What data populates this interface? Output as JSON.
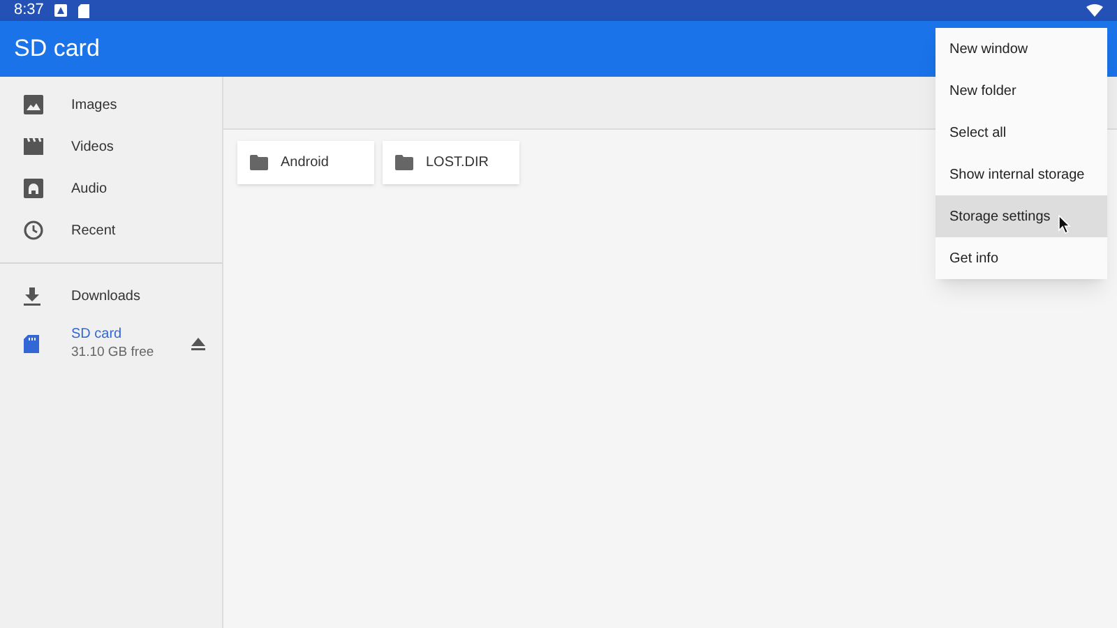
{
  "status_bar": {
    "time": "8:37"
  },
  "app_bar": {
    "title": "SD card"
  },
  "sidebar": {
    "groups": [
      {
        "items": [
          {
            "label": "Images",
            "kind": "images",
            "selected": false
          },
          {
            "label": "Videos",
            "kind": "videos",
            "selected": false
          },
          {
            "label": "Audio",
            "kind": "audio",
            "selected": false
          },
          {
            "label": "Recent",
            "kind": "recent",
            "selected": false
          }
        ]
      },
      {
        "items": [
          {
            "label": "Downloads",
            "kind": "downloads",
            "selected": false
          },
          {
            "label": "SD card",
            "kind": "sdcard",
            "subtitle": "31.10 GB free",
            "ejectable": true,
            "selected": true
          }
        ]
      }
    ]
  },
  "folders": [
    {
      "name": "Android"
    },
    {
      "name": "LOST.DIR"
    }
  ],
  "menu": {
    "items": [
      {
        "label": "New window",
        "selected": false
      },
      {
        "label": "New folder",
        "selected": false
      },
      {
        "label": "Select all",
        "selected": false
      },
      {
        "label": "Show internal storage",
        "selected": false
      },
      {
        "label": "Storage settings",
        "selected": true
      },
      {
        "label": "Get info",
        "selected": false
      }
    ]
  }
}
